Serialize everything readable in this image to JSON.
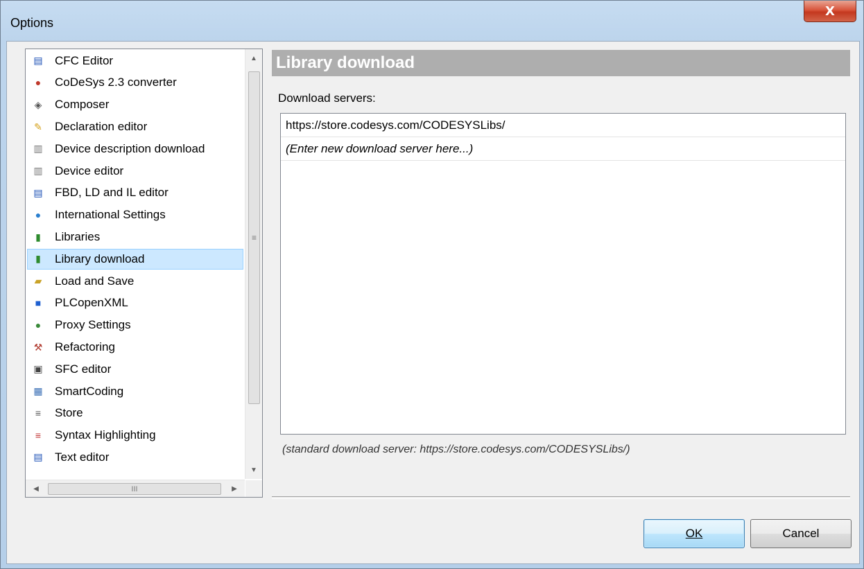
{
  "window": {
    "title": "Options",
    "close_symbol": "X"
  },
  "categories": [
    {
      "label": "CFC Editor",
      "icon": "cfc-editor-icon",
      "selected": false
    },
    {
      "label": "CoDeSys 2.3 converter",
      "icon": "converter-icon",
      "selected": false
    },
    {
      "label": "Composer",
      "icon": "composer-icon",
      "selected": false
    },
    {
      "label": "Declaration editor",
      "icon": "declaration-editor-icon",
      "selected": false
    },
    {
      "label": "Device description download",
      "icon": "device-download-icon",
      "selected": false
    },
    {
      "label": "Device editor",
      "icon": "device-editor-icon",
      "selected": false
    },
    {
      "label": "FBD, LD and IL editor",
      "icon": "fbd-editor-icon",
      "selected": false
    },
    {
      "label": "International Settings",
      "icon": "globe-icon",
      "selected": false
    },
    {
      "label": "Libraries",
      "icon": "libraries-icon",
      "selected": false
    },
    {
      "label": "Library download",
      "icon": "library-download-icon",
      "selected": true
    },
    {
      "label": "Load and Save",
      "icon": "folder-open-icon",
      "selected": false
    },
    {
      "label": "PLCopenXML",
      "icon": "plcopenxml-icon",
      "selected": false
    },
    {
      "label": "Proxy Settings",
      "icon": "proxy-icon",
      "selected": false
    },
    {
      "label": "Refactoring",
      "icon": "refactoring-icon",
      "selected": false
    },
    {
      "label": "SFC editor",
      "icon": "sfc-editor-icon",
      "selected": false
    },
    {
      "label": "SmartCoding",
      "icon": "smartcoding-icon",
      "selected": false
    },
    {
      "label": "Store",
      "icon": "store-icon",
      "selected": false
    },
    {
      "label": "Syntax Highlighting",
      "icon": "syntax-highlighting-icon",
      "selected": false
    },
    {
      "label": "Text editor",
      "icon": "text-editor-icon",
      "selected": false
    }
  ],
  "panel": {
    "title": "Library download",
    "servers_label": "Download servers:",
    "servers": [
      "https://store.codesys.com/CODESYSLibs/"
    ],
    "new_server_placeholder": "(Enter new download server here...)",
    "standard_note": "(standard download server: https://store.codesys.com/CODESYSLibs/)"
  },
  "buttons": {
    "ok": "OK",
    "cancel": "Cancel"
  },
  "colors": {
    "selection": "#cce8ff",
    "header_bg": "#aeaeae",
    "close_button": "#c4381f",
    "default_button": "#bee6fd"
  }
}
